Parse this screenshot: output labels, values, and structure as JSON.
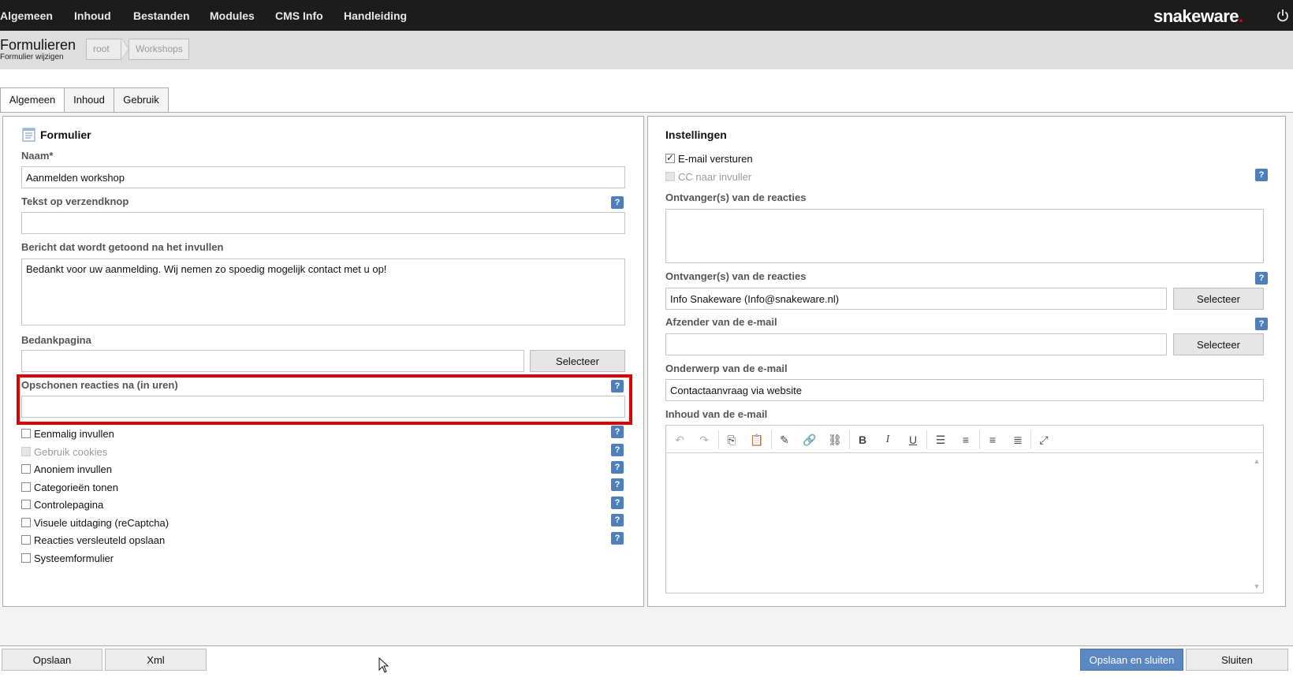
{
  "nav": {
    "items": [
      "Algemeen",
      "Inhoud",
      "Bestanden",
      "Modules",
      "CMS Info",
      "Handleiding"
    ],
    "logo_text": "snakeware",
    "logo_dot": ".",
    "power_icon": "power-icon"
  },
  "header": {
    "title": "Formulieren",
    "subtitle": "Formulier wijzigen",
    "breadcrumbs": [
      "root",
      "Workshops"
    ]
  },
  "tabs": [
    "Algemeen",
    "Inhoud",
    "Gebruik"
  ],
  "left": {
    "section_title": "Formulier",
    "section_icon": "form-icon",
    "name_label": "Naam*",
    "name_value": "Aanmelden workshop",
    "submit_label": "Tekst op verzendknop",
    "submit_value": "",
    "message_label": "Bericht dat wordt getoond na het invullen",
    "message_value": "Bedankt voor uw aanmelding. Wij nemen zo spoedig mogelijk contact met u op!",
    "thanks_label": "Bedankpagina",
    "thanks_value": "",
    "select_label": "Selecteer",
    "cleanup_label": "Opschonen reacties na (in uren)",
    "cleanup_value": "",
    "checkboxes": [
      {
        "label": "Eenmalig invullen",
        "checked": false,
        "disabled": false,
        "help": true
      },
      {
        "label": "Gebruik cookies",
        "checked": false,
        "disabled": true,
        "help": true
      },
      {
        "label": "Anoniem invullen",
        "checked": false,
        "disabled": false,
        "help": true
      },
      {
        "label": "Categorieën tonen",
        "checked": false,
        "disabled": false,
        "help": true
      },
      {
        "label": "Controlepagina",
        "checked": false,
        "disabled": false,
        "help": true
      },
      {
        "label": "Visuele uitdaging (reCaptcha)",
        "checked": false,
        "disabled": false,
        "help": true
      },
      {
        "label": "Reacties versleuteld opslaan",
        "checked": false,
        "disabled": false,
        "help": true
      },
      {
        "label": "Systeemformulier",
        "checked": false,
        "disabled": false,
        "help": false
      }
    ]
  },
  "right": {
    "section_title": "Instellingen",
    "email_send_label": "E-mail versturen",
    "email_send_checked": true,
    "cc_label": "CC naar invuller",
    "cc_disabled": true,
    "recipients_label_1": "Ontvanger(s) van de reacties",
    "recipients_value_1": "",
    "recipients_label_2": "Ontvanger(s) van de reacties",
    "recipients_value_2": "Info Snakeware (Info@snakeware.nl)",
    "sender_label": "Afzender van de e-mail",
    "sender_value": "",
    "subject_label": "Onderwerp van de e-mail",
    "subject_value": "Contactaanvraag via website",
    "content_label": "Inhoud van de e-mail",
    "select_label": "Selecteer"
  },
  "editor_toolbar": {
    "undo": "↶",
    "redo": "↷",
    "copy": "⎘",
    "paste": "📋",
    "edit": "✎",
    "link": "🔗",
    "unlink": "⛓",
    "bold": "B",
    "italic": "I",
    "underline": "U",
    "bullets": "☰",
    "numbers": "≡",
    "align_left": "≡",
    "align_center": "≣",
    "fullscreen": "⤢"
  },
  "bottom": {
    "save": "Opslaan",
    "xml": "Xml",
    "save_close": "Opslaan en sluiten",
    "close": "Sluiten"
  },
  "colors": {
    "nav_bg": "#1c1c1c",
    "header_bg": "#dedede",
    "help_blue": "#4f7fbb",
    "primary_button": "#5b87c3",
    "highlight_red": "#e00000",
    "logo_dot": "#e4001b"
  }
}
